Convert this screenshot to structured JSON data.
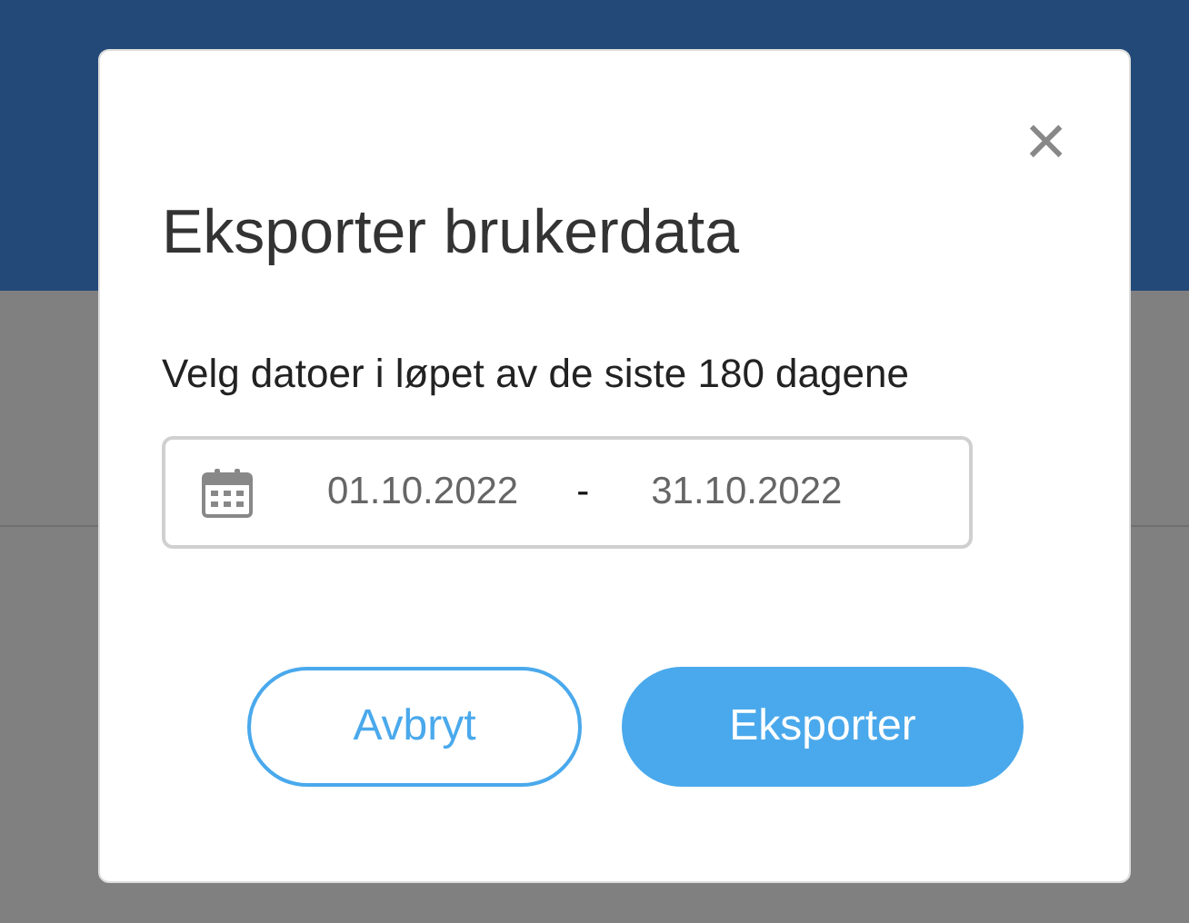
{
  "dialog": {
    "title": "Eksporter brukerdata",
    "close": "×",
    "instruction": "Velg datoer i løpet av de siste 180 dagene",
    "date_range": {
      "start": "01.10.2022",
      "separator": "-",
      "end": "31.10.2022"
    },
    "buttons": [
      {
        "label": "Avbryt",
        "kind": "secondary"
      },
      {
        "label": "Eksporter",
        "kind": "primary"
      }
    ]
  }
}
